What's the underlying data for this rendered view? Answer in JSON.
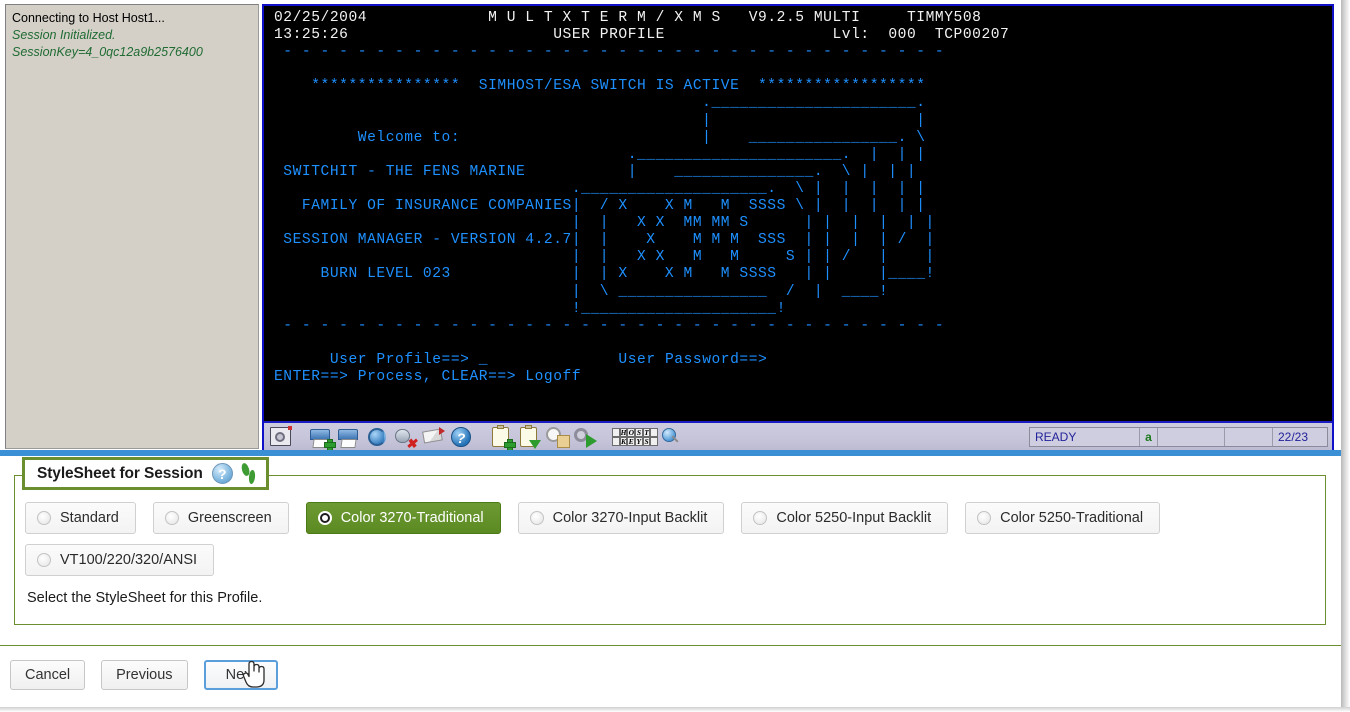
{
  "session_log": {
    "lines": [
      {
        "text": "Connecting to Host Host1...",
        "style": "plain"
      },
      {
        "text": "Session Initialized.",
        "style": "italic-green"
      },
      {
        "text": "SessionKey=4_0qc12a9b2576400",
        "style": "italic-green"
      }
    ]
  },
  "terminal": {
    "header": {
      "date": "02/25/2004",
      "time": "13:25:26",
      "title": "M U L T X T E R M / X M S",
      "version": "V9.2.5 MULTI",
      "user": "TIMMY508",
      "subtitle": "USER PROFILE",
      "level": "Lvl:  000",
      "terminal_id": "TCP00207"
    },
    "banner_line": "*****************  SIMHOST/ESA SWITCH IS ACTIVE  *******************",
    "welcome_lines": [
      "Welcome to:",
      "SWITCHIT - THE FENS MARINE",
      "FAMILY OF INSURANCE COMPANIES",
      "SESSION MANAGER - VERSION 4.2.7",
      "BURN LEVEL 023"
    ],
    "screen_text": "    ****************  SIMHOST/ESA SWITCH IS ACTIVE  ******************\n                                              .______________________.\n                                              |                      |\n         Welcome to:                          |    ________________. \\\n                                      .______________________.  |  | |\n SWITCHIT - THE FENS MARINE           |    _______________.  \\ |  | |\n                                .____________________.  \\ |  |  |  | |\n   FAMILY OF INSURANCE COMPANIES|  / X    X M   M  SSSS \\ |  |  |  | |\n                                |  |   X X  MM MM S      | |  |  |  | |\n SESSION MANAGER - VERSION 4.2.7|  |    X    M M M  SSS  | |  |  | /  |\n                                |  |   X X   M   M     S | | /   |    |\n     BURN LEVEL 023             |  | X    X M   M SSSS   | |     |____!\n                                |  \\ ________________  /  |  ____!\n                                !_____________________!\n",
    "prompts": {
      "user_profile_label": "User Profile==>",
      "user_password_label": "User Password==>",
      "action_line": "ENTER==> Process, CLEAR==> Logoff"
    },
    "toolbar_icons": [
      "screen-settings-icon",
      "print-add-icon",
      "print-icon",
      "refresh-session-icon",
      "disconnect-icon",
      "edit-icon",
      "help-icon",
      "clipboard-add-icon",
      "clipboard-paste-icon",
      "macro-record-icon",
      "macro-run-icon",
      "host-keys-icon",
      "magnify-icon"
    ],
    "status_bar": {
      "state": "READY",
      "indicator": "a",
      "field_3": "",
      "field_4": "",
      "position": "22/23"
    }
  },
  "form": {
    "legend": "StyleSheet for Session",
    "help_icon_glyph": "?",
    "stylesheet_options": [
      {
        "label": "Standard",
        "selected": false
      },
      {
        "label": "Greenscreen",
        "selected": false
      },
      {
        "label": "Color 3270-Traditional",
        "selected": true
      },
      {
        "label": "Color 3270-Input Backlit",
        "selected": false
      },
      {
        "label": "Color 5250-Input Backlit",
        "selected": false
      },
      {
        "label": "Color 5250-Traditional",
        "selected": false
      },
      {
        "label": "VT100/220/320/ANSI",
        "selected": false
      }
    ],
    "hint": "Select the StyleSheet for this Profile.",
    "buttons": [
      {
        "label": "Cancel",
        "focused": false
      },
      {
        "label": "Previous",
        "focused": false
      },
      {
        "label": "Next",
        "focused": true
      }
    ]
  },
  "colors": {
    "accent_green": "#6b8f2e",
    "selected_green": "#5c8a22",
    "terminal_blue": "#1e90ff",
    "terminal_white": "#f2f2f2",
    "frame_blue": "#1010c8",
    "rule_blue": "#3b8fd4",
    "focus_blue": "#5a9fdc"
  }
}
